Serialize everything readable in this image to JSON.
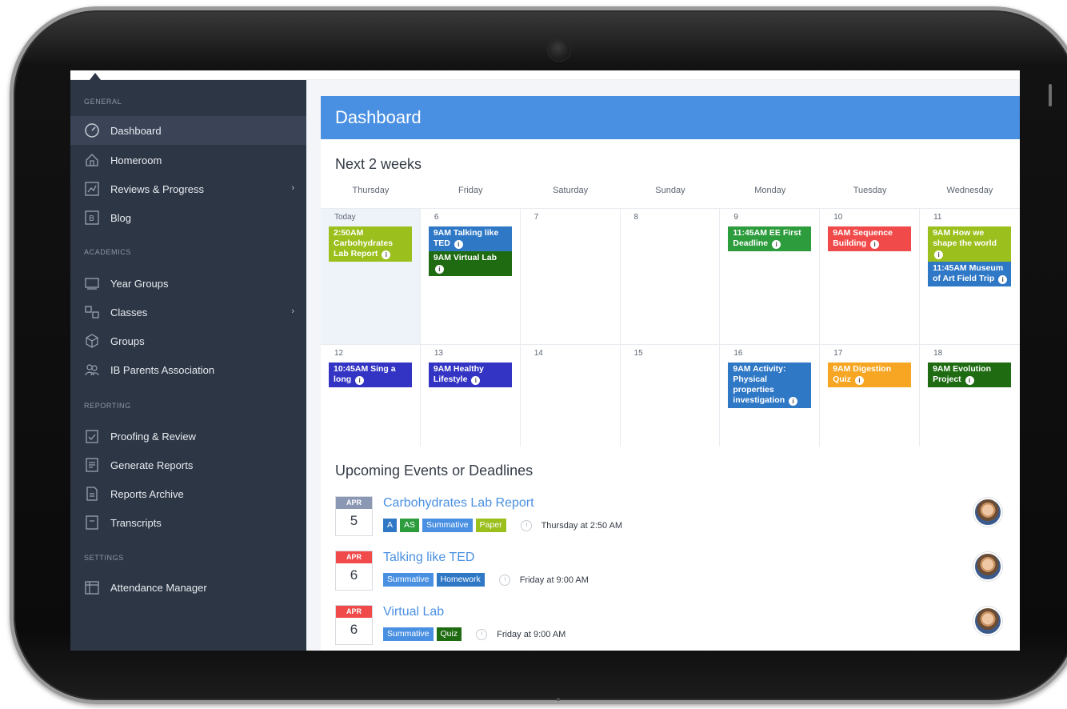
{
  "sidebar": {
    "sections": [
      {
        "label": "GENERAL"
      },
      {
        "label": "ACADEMICS"
      },
      {
        "label": "REPORTING"
      },
      {
        "label": "SETTINGS"
      }
    ],
    "items": [
      {
        "label": "Dashboard",
        "icon": "dashboard-gauge-icon",
        "active": true
      },
      {
        "label": "Homeroom",
        "icon": "home-icon"
      },
      {
        "label": "Reviews & Progress",
        "icon": "chart-icon",
        "has_submenu": true
      },
      {
        "label": "Blog",
        "icon": "blog-icon"
      },
      {
        "label": "Year Groups",
        "icon": "year-groups-icon"
      },
      {
        "label": "Classes",
        "icon": "classes-icon",
        "has_submenu": true
      },
      {
        "label": "Groups",
        "icon": "groups-cube-icon"
      },
      {
        "label": "IB Parents Association",
        "icon": "parents-icon"
      },
      {
        "label": "Proofing & Review",
        "icon": "clipboard-check-icon"
      },
      {
        "label": "Generate Reports",
        "icon": "generate-reports-icon"
      },
      {
        "label": "Reports Archive",
        "icon": "archive-icon"
      },
      {
        "label": "Transcripts",
        "icon": "transcripts-icon"
      },
      {
        "label": "Attendance Manager",
        "icon": "attendance-icon"
      }
    ]
  },
  "main": {
    "title": "Dashboard",
    "calendar_heading": "Next 2 weeks",
    "day_names": [
      "Thursday",
      "Friday",
      "Saturday",
      "Sunday",
      "Monday",
      "Tuesday",
      "Wednesday"
    ],
    "weeks": [
      [
        {
          "label": "Today",
          "today": true,
          "events": [
            {
              "text": "2:50AM Carbohydrates Lab Report",
              "color": "#9bbf1c"
            }
          ]
        },
        {
          "label": "6",
          "events": [
            {
              "text": "9AM Talking like TED",
              "color": "#2f78c6"
            },
            {
              "text": "9AM Virtual Lab",
              "color": "#1f6b12"
            }
          ]
        },
        {
          "label": "7",
          "events": []
        },
        {
          "label": "8",
          "events": []
        },
        {
          "label": "9",
          "events": [
            {
              "text": "11:45AM EE First Deadline",
              "color": "#2c9c3c"
            }
          ]
        },
        {
          "label": "10",
          "events": [
            {
              "text": "9AM Sequence Building",
              "color": "#f04a4a"
            }
          ]
        },
        {
          "label": "11",
          "events": [
            {
              "text": "9AM How we shape the world",
              "color": "#9bbf1c"
            },
            {
              "text": "11:45AM Museum of Art Field Trip",
              "color": "#2f78c6"
            }
          ]
        }
      ],
      [
        {
          "label": "12",
          "events": [
            {
              "text": "10:45AM Sing a long",
              "color": "#3434c4"
            }
          ]
        },
        {
          "label": "13",
          "events": [
            {
              "text": "9AM Healthy Lifestyle",
              "color": "#3434c4"
            }
          ]
        },
        {
          "label": "14",
          "events": []
        },
        {
          "label": "15",
          "events": []
        },
        {
          "label": "16",
          "events": [
            {
              "text": "9AM Activity: Physical properties investigation",
              "color": "#2f78c6"
            }
          ]
        },
        {
          "label": "17",
          "events": [
            {
              "text": "9AM Digestion Quiz",
              "color": "#f6a623"
            }
          ]
        },
        {
          "label": "18",
          "events": [
            {
              "text": "9AM Evolution Project",
              "color": "#1f6b12"
            }
          ]
        }
      ]
    ],
    "upcoming_heading": "Upcoming Events or Deadlines",
    "upcoming": [
      {
        "month": "APR",
        "month_color": "#8a98b3",
        "day": "5",
        "title": "Carbohydrates Lab Report",
        "tags": [
          {
            "label": "A",
            "color": "#2f78c6"
          },
          {
            "label": "AS",
            "color": "#2c9c3c"
          },
          {
            "label": "Summative",
            "color": "#4a90e2"
          },
          {
            "label": "Paper",
            "color": "#9bbf1c"
          }
        ],
        "when": "Thursday at 2:50 AM"
      },
      {
        "month": "APR",
        "month_color": "#f04a4a",
        "day": "6",
        "title": "Talking like TED",
        "tags": [
          {
            "label": "Summative",
            "color": "#4a90e2"
          },
          {
            "label": "Homework",
            "color": "#2f78c6"
          }
        ],
        "when": "Friday at 9:00 AM"
      },
      {
        "month": "APR",
        "month_color": "#f04a4a",
        "day": "6",
        "title": "Virtual Lab",
        "tags": [
          {
            "label": "Summative",
            "color": "#4a90e2"
          },
          {
            "label": "Quiz",
            "color": "#1f6b12"
          }
        ],
        "when": "Friday at 9:00 AM"
      }
    ]
  },
  "colors": {
    "sidebar_bg": "#2d3645",
    "header_blue": "#4a90e2"
  }
}
